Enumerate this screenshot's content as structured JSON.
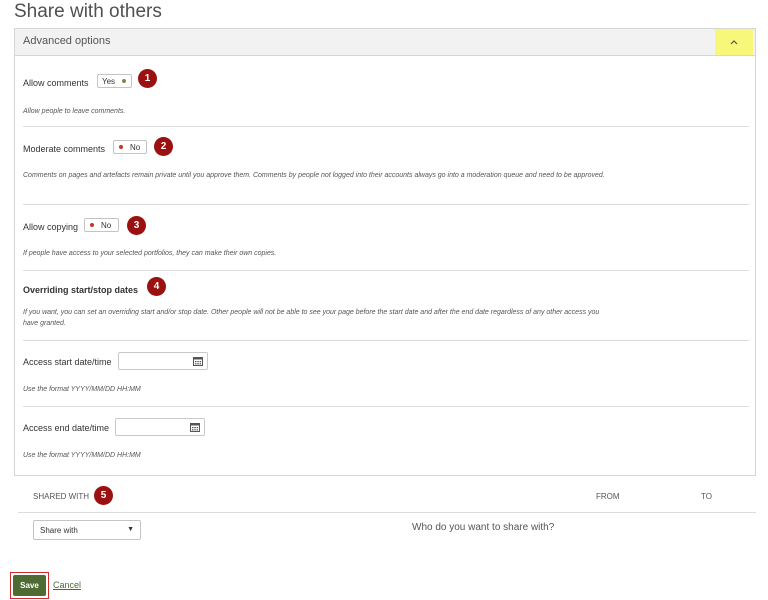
{
  "page": {
    "title": "Share with others"
  },
  "panel": {
    "title": "Advanced options",
    "collapse_icon": "chevron-up-icon"
  },
  "allow_comments": {
    "label": "Allow comments",
    "value": "Yes",
    "badge": "1",
    "description": "Allow people to leave comments."
  },
  "moderate_comments": {
    "label": "Moderate comments",
    "value": "No",
    "badge": "2",
    "description": "Comments on pages and artefacts remain private until you approve them. Comments by people not logged into their accounts always go into a moderation queue and need to be approved."
  },
  "allow_copying": {
    "label": "Allow copying",
    "value": "No",
    "badge": "3",
    "description": "If people have access to your selected portfolios, they can make their own copies."
  },
  "overriding_dates": {
    "heading": "Overriding start/stop dates",
    "badge": "4",
    "description": "If you want, you can set an overriding start and/or stop date. Other people will not be able to see your page before the start date and after the end date regardless of any other access you have granted."
  },
  "access_start": {
    "label": "Access start date/time",
    "value": "",
    "hint": "Use the format YYYY/MM/DD HH:MM"
  },
  "access_end": {
    "label": "Access end date/time",
    "value": "",
    "hint": "Use the format YYYY/MM/DD HH:MM"
  },
  "shared_with": {
    "badge": "5",
    "columns": {
      "shared_with": "SHARED WITH",
      "from": "FROM",
      "to": "TO"
    },
    "select_value": "Share with",
    "prompt": "Who do you want to share with?"
  },
  "actions": {
    "save": "Save",
    "cancel": "Cancel"
  },
  "colors": {
    "accent": "#4f6b34",
    "badge": "#9b1111",
    "highlight": "#f7f779",
    "toggle_yes_dot": "#7a8a4e",
    "toggle_no_dot": "#c0392b"
  }
}
